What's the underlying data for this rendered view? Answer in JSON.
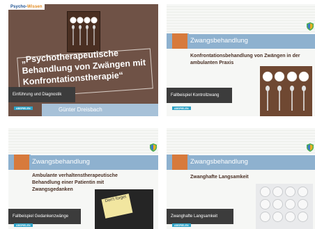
{
  "cards": [
    {
      "logo": {
        "text_left": "Psycho-",
        "text_right": "Wissen"
      },
      "title": "„Psychotherapeutische Behandlung von Zwängen mit Konfrontationstherapie“",
      "label": "Einführung und Diagnostik",
      "button": "ABSPIELEN",
      "author": "Günter Dreisbach"
    },
    {
      "header": "Zwangsbehandlung",
      "subtitle": "Konfrontationsbehandlung von Zwängen in der ambulanten Praxis",
      "label": "Fallbeispiel Kontrollzwang",
      "button": "ABSPIELEN"
    },
    {
      "header": "Zwangsbehandlung",
      "subtitle": "Ambulante verhaltenstherapeutische Behandlung einer Patientin mit Zwangsgedanken",
      "label": "Fallbeispiel Gedankenzwänge",
      "button": "ABSPIELEN",
      "note": "Don't forget"
    },
    {
      "header": "Zwangsbehandlung",
      "subtitle": "Zwanghafte Langsamkeit",
      "label": "Zwanghafte Langsamkeit",
      "button": "ABSPIELEN"
    }
  ],
  "icons": {
    "cups": "coffee-cups-photo",
    "badge": "shield-badge-icon",
    "keys": "keypad-photo"
  },
  "colors": {
    "brown": "#6f5246",
    "header_blue": "#8eb1cf",
    "header_orange": "#d77a3c",
    "label_dark": "#3c3c3c",
    "button_blue": "#2ea3c7"
  }
}
